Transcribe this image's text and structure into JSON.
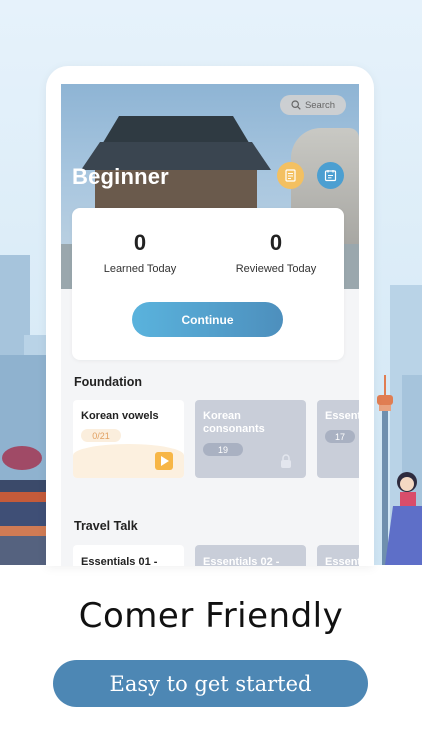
{
  "search": {
    "label": "Search"
  },
  "hero": {
    "level_title": "Beginner"
  },
  "stats": [
    {
      "value": "0",
      "label": "Learned Today"
    },
    {
      "value": "0",
      "label": "Reviewed Today"
    }
  ],
  "continue_label": "Continue",
  "sections": [
    {
      "title": "Foundation",
      "cards": [
        {
          "title": "Korean vowels",
          "count": "0/21",
          "state": "active"
        },
        {
          "title": "Korean consonants",
          "count": "19",
          "state": "locked"
        },
        {
          "title": "Essent",
          "count": "17",
          "state": "locked"
        }
      ]
    },
    {
      "title": "Travel Talk",
      "cards": [
        {
          "title": "Essentials 01 -",
          "state": "active"
        },
        {
          "title": "Essentials 02 -",
          "state": "locked"
        },
        {
          "title": "Essent",
          "state": "locked"
        }
      ]
    }
  ],
  "promo": {
    "headline": "Comer Friendly",
    "cta_label": "Easy to get started"
  },
  "colors": {
    "accent": "#4d87b4",
    "continue_gradient_start": "#5ab3dd",
    "continue_gradient_end": "#4d8fbd",
    "count_pill_active": "#e1a062"
  }
}
